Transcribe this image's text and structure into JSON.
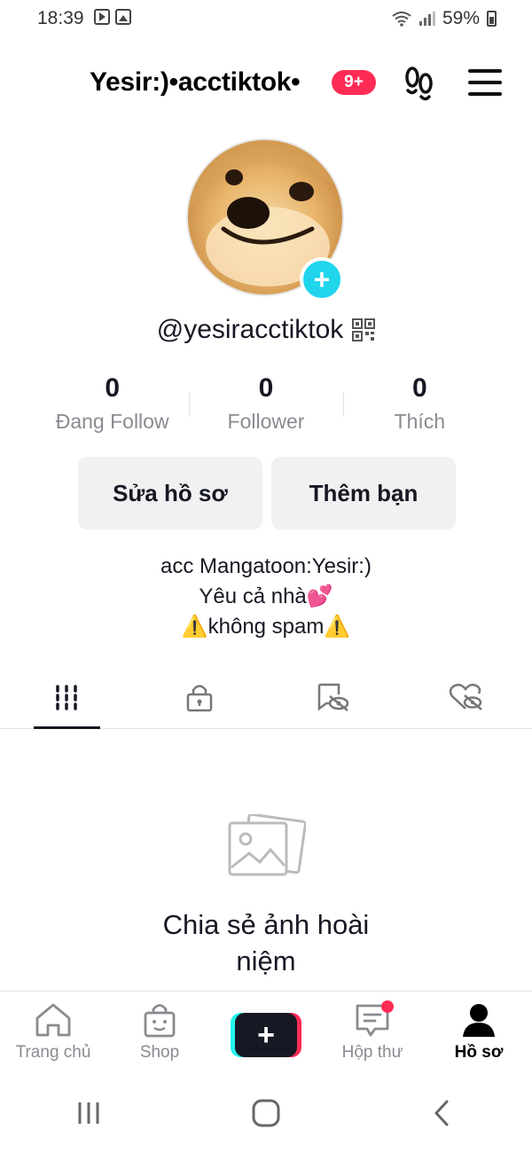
{
  "status_bar": {
    "time": "18:39",
    "battery": "59%"
  },
  "header": {
    "title": "Yesir:)•acctiktok•",
    "notification_badge": "9+"
  },
  "profile": {
    "handle": "@yesiracctiktok",
    "stats": [
      {
        "value": "0",
        "label": "Đang Follow"
      },
      {
        "value": "0",
        "label": "Follower"
      },
      {
        "value": "0",
        "label": "Thích"
      }
    ],
    "edit_button": "Sửa hồ sơ",
    "add_friends_button": "Thêm bạn",
    "bio_lines": [
      "acc Mangatoon:Yesir:)",
      "Yêu cả nhà💕",
      "⚠️không spam⚠️"
    ]
  },
  "tabs": [
    "videos",
    "private",
    "reposts",
    "liked"
  ],
  "empty_state": {
    "line1": "Chia sẻ ảnh hoài",
    "line2": "niệm"
  },
  "bottom_nav": [
    {
      "label": "Trang chủ",
      "icon": "home-icon"
    },
    {
      "label": "Shop",
      "icon": "shop-bag-icon"
    },
    {
      "label": "",
      "icon": "create-plus-icon"
    },
    {
      "label": "Hộp thư",
      "icon": "inbox-icon"
    },
    {
      "label": "Hồ sơ",
      "icon": "profile-icon"
    }
  ],
  "colors": {
    "accent_red": "#fe2c55",
    "accent_cyan": "#25f4ee",
    "avatar_plus": "#20d5ec",
    "text_primary": "#161823",
    "text_secondary": "#8a8b91"
  }
}
